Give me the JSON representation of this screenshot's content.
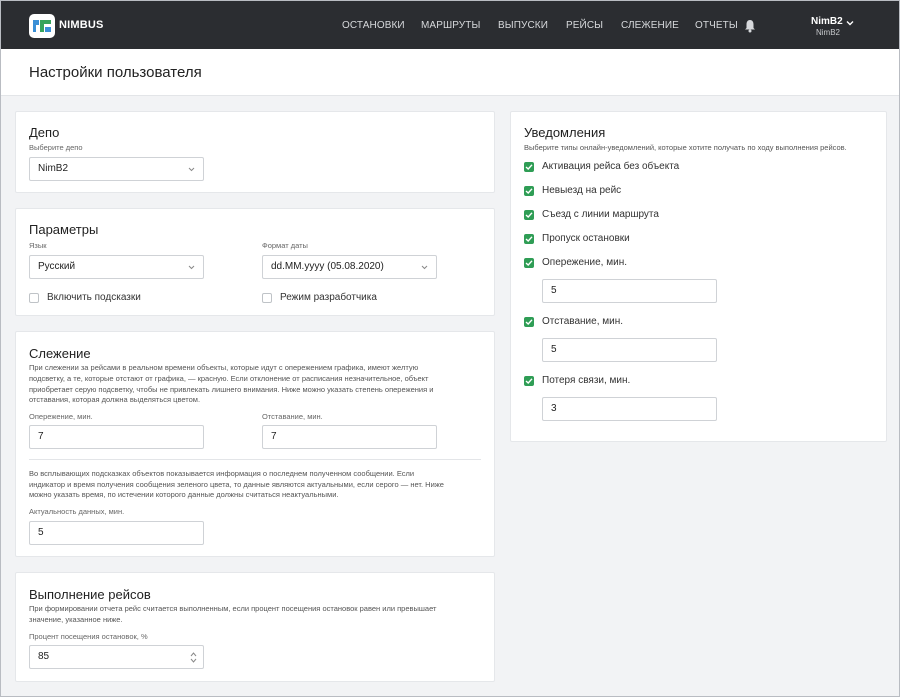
{
  "nav": {
    "brand": "NIMBUS",
    "items": [
      "ОСТАНОВКИ",
      "МАРШРУТЫ",
      "ВЫПУСКИ",
      "РЕЙСЫ",
      "СЛЕЖЕНИЕ",
      "ОТЧЕТЫ"
    ],
    "user_name": "NimB2",
    "user_sub": "NimB2"
  },
  "page": {
    "title": "Настройки пользователя"
  },
  "depot": {
    "title": "Депо",
    "label": "Выберите депо",
    "value": "NimB2"
  },
  "params": {
    "title": "Параметры",
    "language_label": "Язык",
    "language_value": "Русский",
    "date_format_label": "Формат даты",
    "date_format_value": "dd.MM.yyyy (05.08.2020)",
    "hints_label": "Включить подсказки",
    "hints_checked": false,
    "dev_label": "Режим разработчика",
    "dev_checked": false
  },
  "tracking": {
    "title": "Слежение",
    "desc1": "При слежении за рейсами в реальном времени объекты, которые идут с опережением графика, имеют желтую",
    "desc2": "подсветку, а те, которые отстают от графика, — красную. Если отклонение от расписания незначительное, объект",
    "desc3": "приобретает серую подсветку, чтобы не привлекать лишнего внимания. Ниже можно указать степень опережения и",
    "desc4": "отставания, которая должна выделяться цветом.",
    "ahead_label": "Опережение, мин.",
    "ahead_value": "7",
    "behind_label": "Отставание, мин.",
    "behind_value": "7",
    "info1": "Во всплывающих подсказках объектов показывается информация о последнем полученном сообщении. Если",
    "info2": "индикатор и время получения сообщения зеленого цвета, то данные являются актуальными, если серого — нет. Ниже",
    "info3": "можно указать время, по истечении которого данные должны считаться неактуальными.",
    "relevance_label": "Актуальность данных, мин.",
    "relevance_value": "5"
  },
  "completion": {
    "title": "Выполнение рейсов",
    "desc1": "При формировании отчета рейс считается выполненным, если процент посещения остановок равен или превышает",
    "desc2": "значение, указанное ниже.",
    "percent_label": "Процент посещения остановок, %",
    "percent_value": "85"
  },
  "notifications": {
    "title": "Уведомления",
    "desc": "Выберите типы онлайн-уведомлений, которые хотите получать по ходу выполнения рейсов.",
    "items": [
      {
        "label": "Активация рейса без объекта",
        "checked": true
      },
      {
        "label": "Невыезд на рейс",
        "checked": true
      },
      {
        "label": "Съезд с линии маршрута",
        "checked": true
      },
      {
        "label": "Пропуск остановки",
        "checked": true
      },
      {
        "label": "Опережение, мин.",
        "checked": true,
        "value": "5"
      },
      {
        "label": "Отставание, мин.",
        "checked": true,
        "value": "5"
      },
      {
        "label": "Потеря связи, мин.",
        "checked": true,
        "value": "3"
      }
    ]
  },
  "colors": {
    "topbar": "#2b2d31",
    "check_green": "#2f9d55",
    "background": "#f2f3f5"
  }
}
